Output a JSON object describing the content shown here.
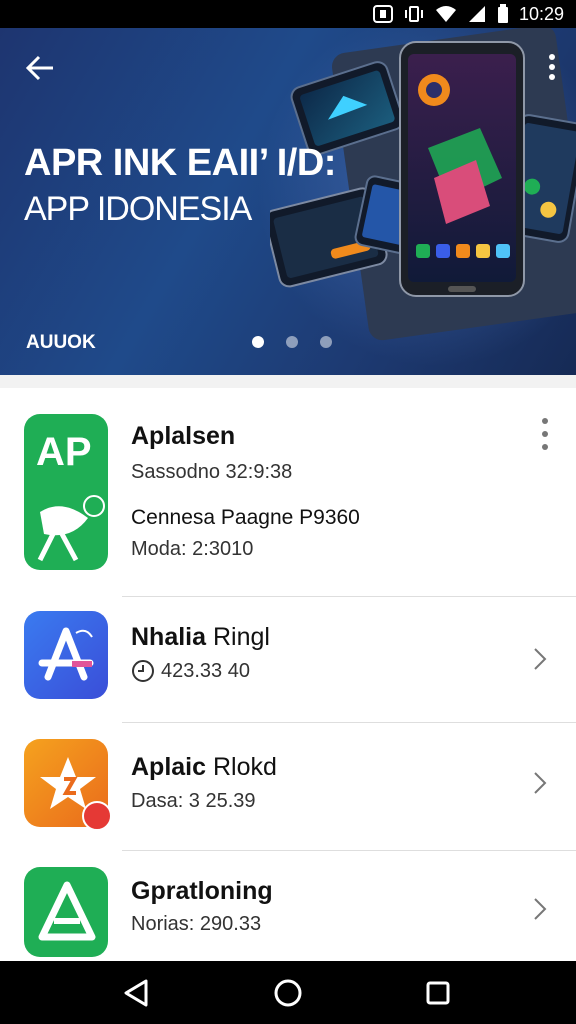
{
  "status_bar": {
    "time": "10:29"
  },
  "hero": {
    "title": "APR INK EAII’ I/D:",
    "subtitle": "APP IDONESIA",
    "tag": "AUUOK",
    "dots": 3,
    "active_dot": 0
  },
  "apps": [
    {
      "name_bold": "Aplalsen",
      "name_light": "",
      "line1": "Sassodno 32:9:38",
      "line2": "Cennesa Paagne P9360",
      "line3": "Moda: 2:3010",
      "icon_label": "AP",
      "icon_color": "#1fae55",
      "action": "more-vert-icon"
    },
    {
      "name_bold": "Nhalia",
      "name_light": " Ringl",
      "line1": "423.33 40",
      "icon_color": "#3a5ee8",
      "action": "chevron-right-icon"
    },
    {
      "name_bold": "Aplaic",
      "name_light": " Rlokd",
      "line1": "Dasa: 3 25.39",
      "icon_color": "#f08a1c",
      "action": "chevron-right-icon"
    },
    {
      "name_bold": "Gpratloning",
      "name_light": "",
      "line1": "Norias: 290.33",
      "icon_color": "#1fae55",
      "action": "chevron-right-icon"
    }
  ],
  "colors": {
    "hero_bg": "#1f4a8a",
    "card_bg": "#ffffff",
    "status_bar_bg": "#000000"
  }
}
